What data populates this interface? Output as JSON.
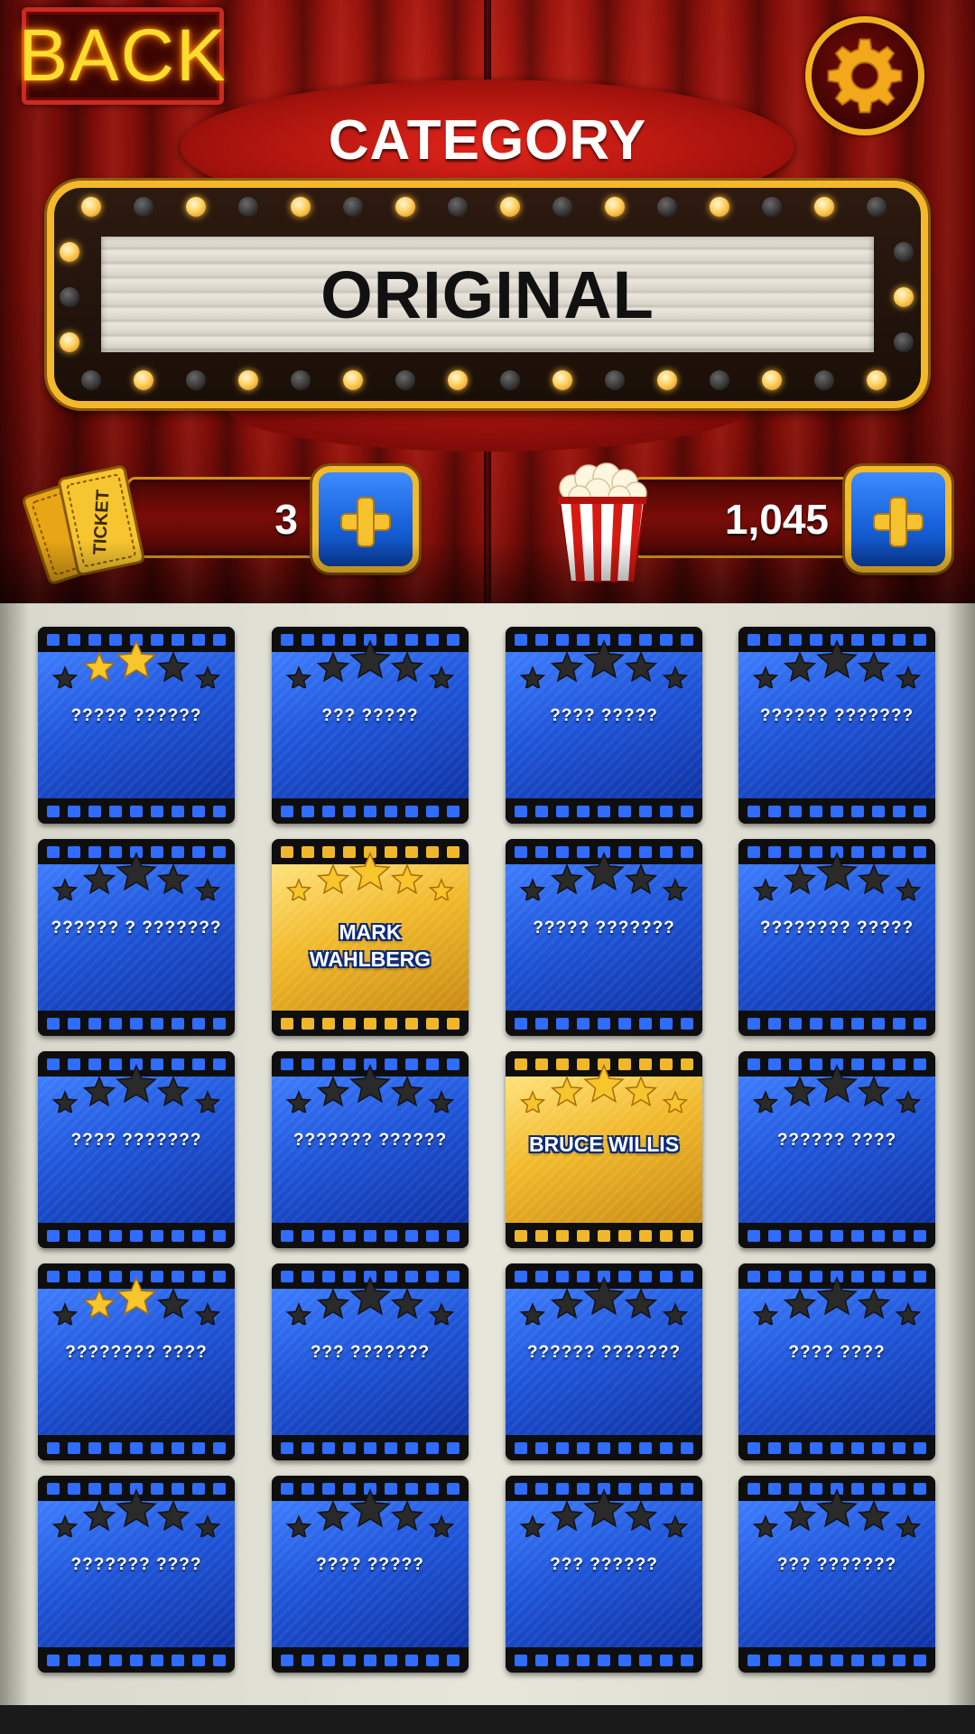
{
  "header": {
    "back_label": "BACK",
    "category_heading": "CATEGORY",
    "category_name": "ORIGINAL",
    "settings_icon": "gear-icon"
  },
  "counters": {
    "tickets": {
      "value": "3",
      "icon": "ticket-icon"
    },
    "popcorn": {
      "value": "1,045",
      "icon": "popcorn-icon"
    }
  },
  "colors": {
    "curtain": "#a3120c",
    "gold": "#f3b92a",
    "card_blue": "#1f55d8",
    "card_gold": "#f1b92a",
    "star_filled": "#f7c52c",
    "star_empty": "#2a2a2a"
  },
  "cards": [
    {
      "label": "????? ??????",
      "stars": 2,
      "unlocked": false
    },
    {
      "label": "??? ?????",
      "stars": 0,
      "unlocked": false
    },
    {
      "label": "???? ?????",
      "stars": 0,
      "unlocked": false
    },
    {
      "label": "?????? ???????",
      "stars": 0,
      "unlocked": false
    },
    {
      "label": "?????? ? ???????",
      "stars": 0,
      "unlocked": false
    },
    {
      "label": "MARK WAHLBERG",
      "stars": 5,
      "unlocked": true
    },
    {
      "label": "????? ???????",
      "stars": 0,
      "unlocked": false
    },
    {
      "label": "???????? ?????",
      "stars": 0,
      "unlocked": false
    },
    {
      "label": "???? ???????",
      "stars": 0,
      "unlocked": false
    },
    {
      "label": "??????? ??????",
      "stars": 0,
      "unlocked": false
    },
    {
      "label": "BRUCE WILLIS",
      "stars": 5,
      "unlocked": true
    },
    {
      "label": "?????? ????",
      "stars": 0,
      "unlocked": false
    },
    {
      "label": "???????? ????",
      "stars": 2,
      "unlocked": false
    },
    {
      "label": "??? ???????",
      "stars": 0,
      "unlocked": false
    },
    {
      "label": "?????? ???????",
      "stars": 0,
      "unlocked": false
    },
    {
      "label": "???? ????",
      "stars": 0,
      "unlocked": false
    },
    {
      "label": "??????? ????",
      "stars": 0,
      "unlocked": false
    },
    {
      "label": "???? ?????",
      "stars": 0,
      "unlocked": false
    },
    {
      "label": "??? ??????",
      "stars": 0,
      "unlocked": false
    },
    {
      "label": "??? ???????",
      "stars": 0,
      "unlocked": false
    }
  ]
}
